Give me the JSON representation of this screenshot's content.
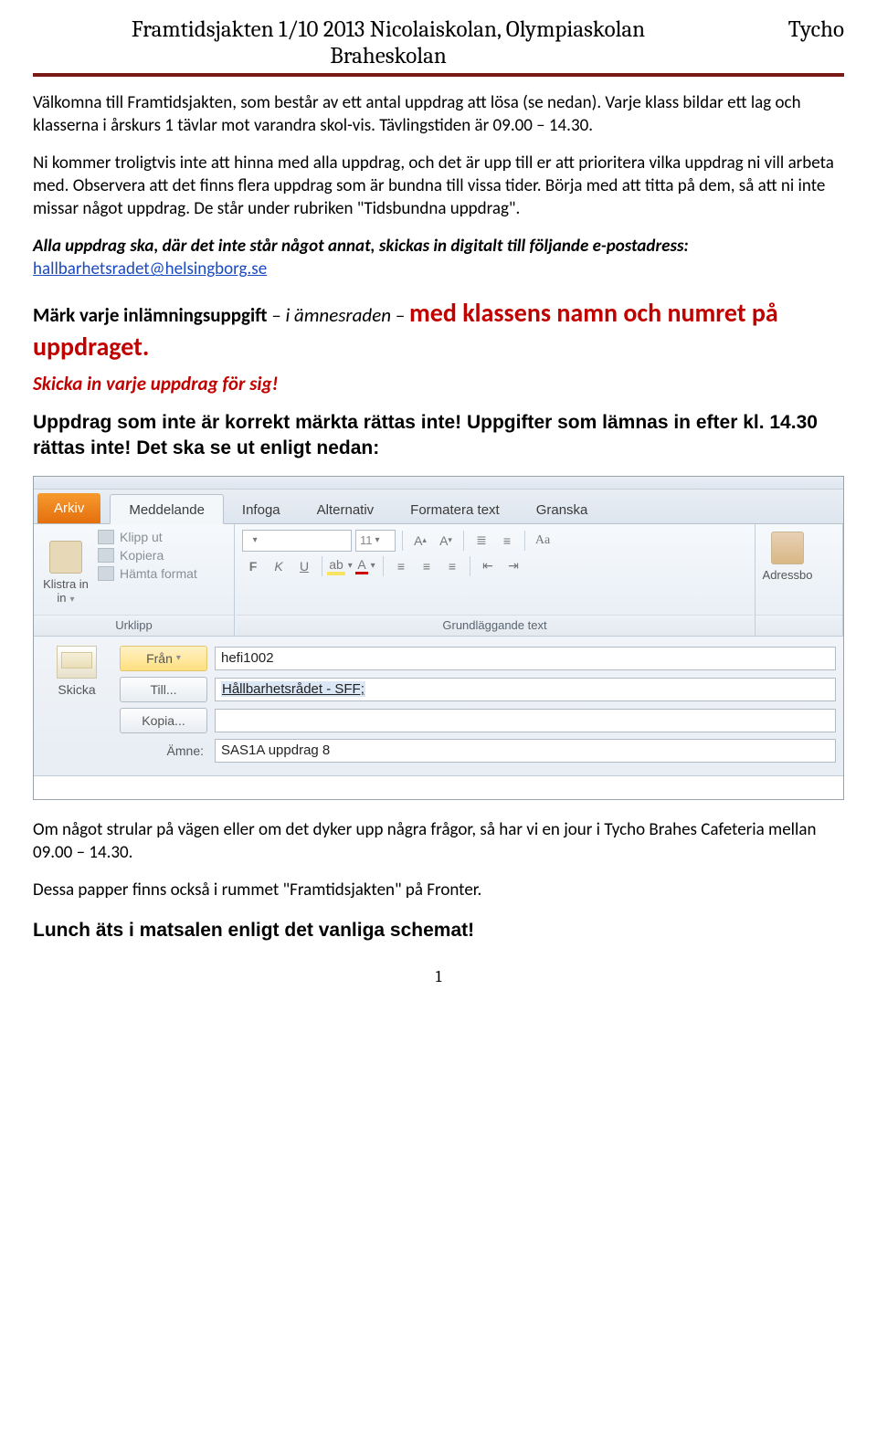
{
  "header": {
    "title_left": "Framtidsjakten 1/10 2013 Nicolaiskolan, Olympiaskolan",
    "title_line2": "Braheskolan",
    "title_right": "Tycho"
  },
  "paragraphs": {
    "p1": "Välkomna till Framtidsjakten, som består av ett antal uppdrag att lösa (se nedan). Varje klass bildar ett lag och klasserna i årskurs 1 tävlar mot varandra skol-vis. Tävlingstiden är 09.00 – 14.30.",
    "p2": "Ni kommer troligtvis inte att hinna med alla uppdrag, och det är upp till er att prioritera vilka uppdrag ni vill arbeta med. Observera att det finns flera uppdrag som är bundna till vissa tider. Börja med att titta på dem, så att ni inte missar något uppdrag. De står under rubriken \"Tidsbundna uppdrag\".",
    "p3_lead": "Alla uppdrag ska, där det inte står något annat, skickas in digitalt till följande e-postadress: ",
    "p3_email": "hallbarhetsradet@helsingborg.se",
    "p4_lead": "Märk varje inlämningsuppgift ",
    "p4_ital": "– i ämnesraden – ",
    "p4_red1": "med klassens namn och numret på uppdraget.",
    "p4_red2": " Skicka in varje uppdrag för sig!",
    "p5": "Uppdrag som inte är korrekt märkta rättas inte! Uppgifter som lämnas in efter kl. 14.30 rättas inte! Det ska se ut enligt nedan:",
    "p6": "Om något strular på vägen eller om det dyker upp några frågor, så har vi en jour i Tycho Brahes Cafeteria mellan 09.00 – 14.30.",
    "p7": "Dessa papper finns också i rummet \"Framtidsjakten\" på Fronter.",
    "p8": "Lunch äts i matsalen enligt det vanliga schemat!"
  },
  "outlook": {
    "tabs": {
      "arkiv": "Arkiv",
      "meddelande": "Meddelande",
      "infoga": "Infoga",
      "alternativ": "Alternativ",
      "formatera": "Formatera text",
      "granska": "Granska"
    },
    "clipboard": {
      "paste": "Klistra in",
      "cut": "Klipp ut",
      "copy": "Kopiera",
      "format_painter": "Hämta format",
      "group_label": "Urklipp"
    },
    "font": {
      "size_value": "11",
      "group_label": "Grundläggande text",
      "bold": "F",
      "italic": "K",
      "underline": "U"
    },
    "address": {
      "label": "Adressbo"
    },
    "compose": {
      "send": "Skicka",
      "from_label": "Från",
      "from_value": "hefi1002",
      "to_label": "Till...",
      "to_value": "Hållbarhetsrådet - SFF;",
      "cc_label": "Kopia...",
      "cc_value": "",
      "subject_label": "Ämne:",
      "subject_value": "SAS1A uppdrag 8"
    }
  },
  "page_number": "1"
}
